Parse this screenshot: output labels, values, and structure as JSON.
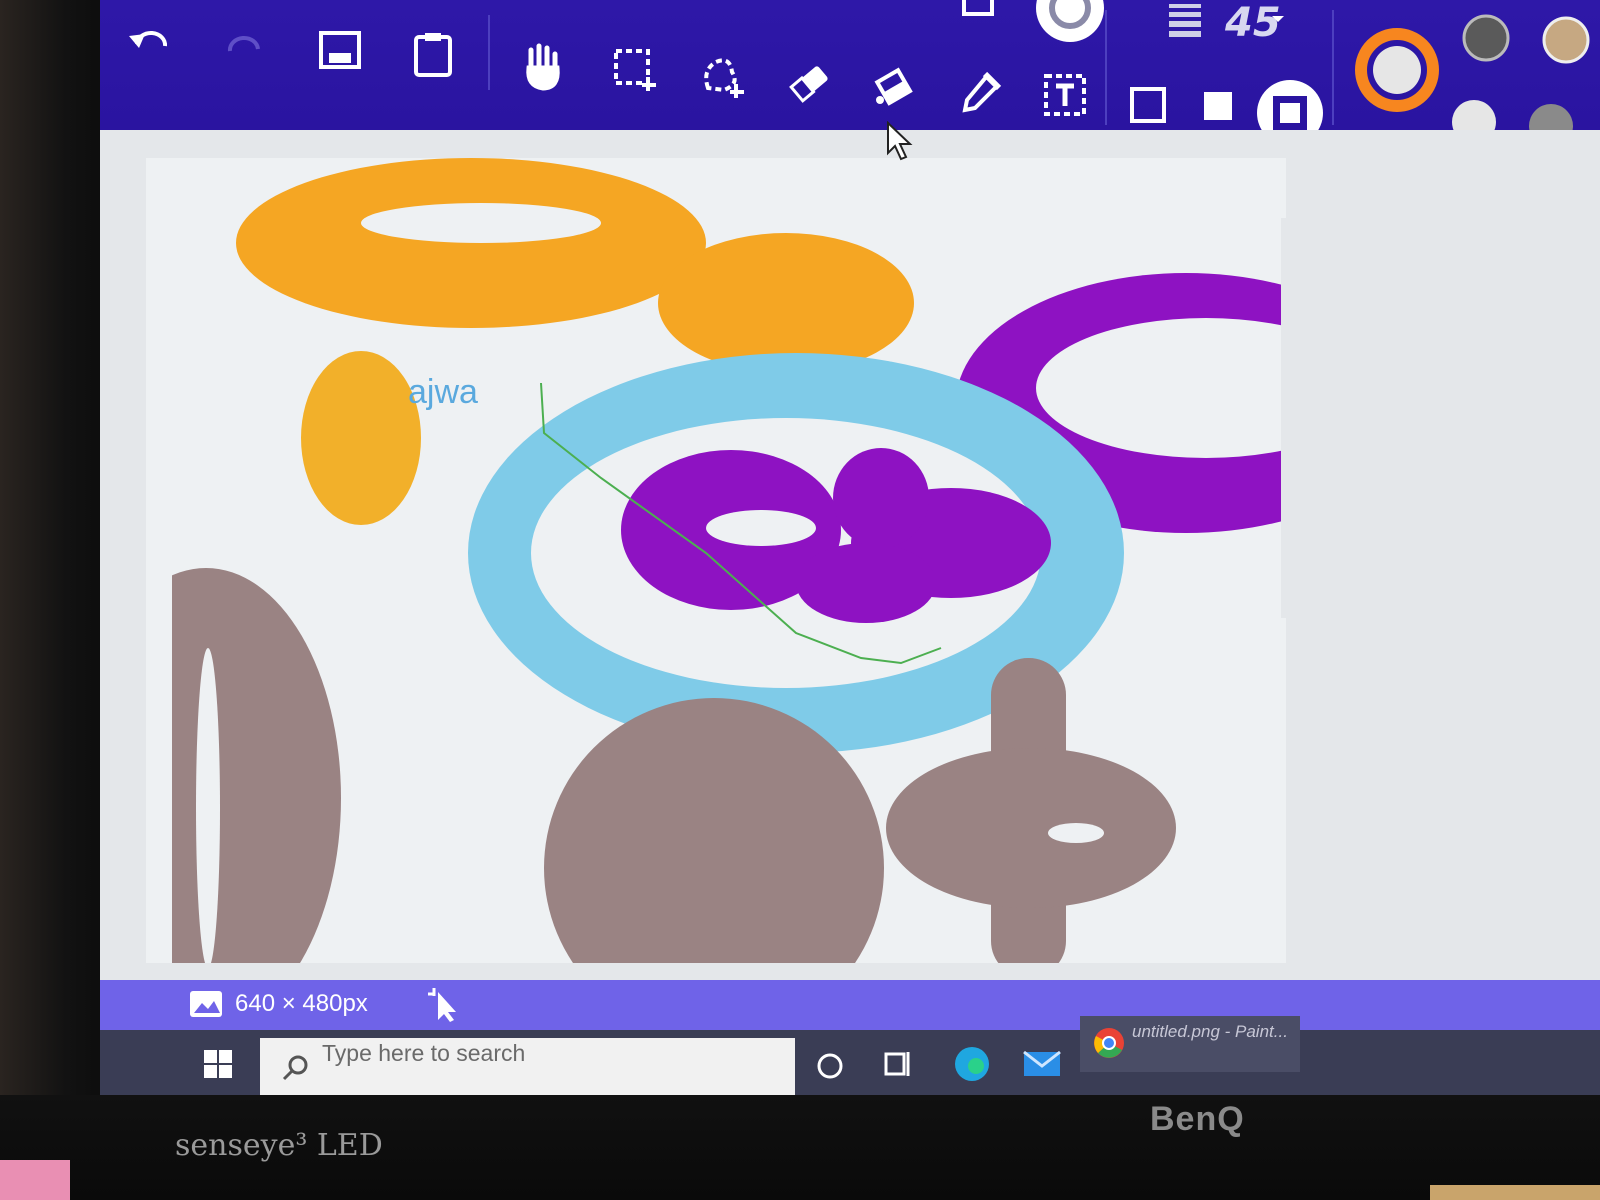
{
  "app": {
    "brush_size": "45",
    "canvas_label": "ajwa"
  },
  "toolbar": {
    "tools": [
      {
        "name": "undo-icon"
      },
      {
        "name": "redo-icon"
      },
      {
        "name": "save-image-icon"
      },
      {
        "name": "clipboard-icon"
      },
      {
        "name": "hand-icon"
      },
      {
        "name": "rect-select-icon"
      },
      {
        "name": "lasso-select-icon"
      },
      {
        "name": "eraser-icon"
      },
      {
        "name": "fill-bucket-icon"
      },
      {
        "name": "color-picker-icon"
      },
      {
        "name": "text-tool-icon"
      }
    ],
    "colors": {
      "primary": "#f7861f",
      "swatch_1": "#5a5a5a",
      "swatch_2": "#e6e6e6",
      "swatch_3": "#8a8a8a"
    }
  },
  "canvas": {
    "colors": {
      "orange": "#f5a623",
      "yellow": "#f2b02a",
      "sky": "#7fcbe8",
      "purple": "#8e12c2",
      "brown": "#9a8383",
      "line": "#4caf50",
      "text": "#5aa9de"
    }
  },
  "status": {
    "dimensions": "640 × 480px"
  },
  "taskbar": {
    "search_placeholder": "Type here to search",
    "app_label": "untitled.png - Paint..."
  },
  "monitor": {
    "brand_left": "senseye³ LED",
    "brand_right": "BenQ"
  }
}
